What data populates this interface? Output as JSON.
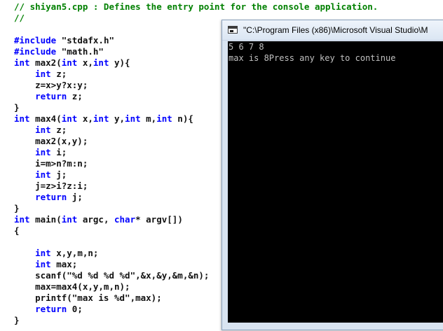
{
  "colors": {
    "comment": "#008000",
    "keyword": "#0000ff",
    "text": "#111111",
    "console_bg": "#000000",
    "console_text": "#c0c0c0"
  },
  "editor": {
    "lines": [
      [
        {
          "t": "cm",
          "s": "// shiyan5.cpp : Defines the entry point for the console application."
        }
      ],
      [
        {
          "t": "cm",
          "s": "//"
        }
      ],
      [],
      [
        {
          "t": "pp",
          "s": "#include"
        },
        {
          "t": "tx",
          "s": " \"stdafx.h\""
        }
      ],
      [
        {
          "t": "pp",
          "s": "#include"
        },
        {
          "t": "tx",
          "s": " \"math.h\""
        }
      ],
      [
        {
          "t": "kw",
          "s": "int"
        },
        {
          "t": "tx",
          "s": " max2("
        },
        {
          "t": "kw",
          "s": "int"
        },
        {
          "t": "tx",
          "s": " x,"
        },
        {
          "t": "kw",
          "s": "int"
        },
        {
          "t": "tx",
          "s": " y){"
        }
      ],
      [
        {
          "t": "tx",
          "s": "    "
        },
        {
          "t": "kw",
          "s": "int"
        },
        {
          "t": "tx",
          "s": " z;"
        }
      ],
      [
        {
          "t": "tx",
          "s": "    z=x>y?x:y;"
        }
      ],
      [
        {
          "t": "tx",
          "s": "    "
        },
        {
          "t": "kw",
          "s": "return"
        },
        {
          "t": "tx",
          "s": " z;"
        }
      ],
      [
        {
          "t": "tx",
          "s": "}"
        }
      ],
      [
        {
          "t": "kw",
          "s": "int"
        },
        {
          "t": "tx",
          "s": " max4("
        },
        {
          "t": "kw",
          "s": "int"
        },
        {
          "t": "tx",
          "s": " x,"
        },
        {
          "t": "kw",
          "s": "int"
        },
        {
          "t": "tx",
          "s": " y,"
        },
        {
          "t": "kw",
          "s": "int"
        },
        {
          "t": "tx",
          "s": " m,"
        },
        {
          "t": "kw",
          "s": "int"
        },
        {
          "t": "tx",
          "s": " n){"
        }
      ],
      [
        {
          "t": "tx",
          "s": "    "
        },
        {
          "t": "kw",
          "s": "int"
        },
        {
          "t": "tx",
          "s": " z;"
        }
      ],
      [
        {
          "t": "tx",
          "s": "    max2(x,y);"
        }
      ],
      [
        {
          "t": "tx",
          "s": "    "
        },
        {
          "t": "kw",
          "s": "int"
        },
        {
          "t": "tx",
          "s": " i;"
        }
      ],
      [
        {
          "t": "tx",
          "s": "    i=m>n?m:n;"
        }
      ],
      [
        {
          "t": "tx",
          "s": "    "
        },
        {
          "t": "kw",
          "s": "int"
        },
        {
          "t": "tx",
          "s": " j;"
        }
      ],
      [
        {
          "t": "tx",
          "s": "    j=z>i?z:i;"
        }
      ],
      [
        {
          "t": "tx",
          "s": "    "
        },
        {
          "t": "kw",
          "s": "return"
        },
        {
          "t": "tx",
          "s": " j;"
        }
      ],
      [
        {
          "t": "tx",
          "s": "}"
        }
      ],
      [
        {
          "t": "kw",
          "s": "int"
        },
        {
          "t": "tx",
          "s": " main("
        },
        {
          "t": "kw",
          "s": "int"
        },
        {
          "t": "tx",
          "s": " argc, "
        },
        {
          "t": "kw",
          "s": "char"
        },
        {
          "t": "tx",
          "s": "* argv[])"
        }
      ],
      [
        {
          "t": "tx",
          "s": "{"
        }
      ],
      [],
      [
        {
          "t": "tx",
          "s": "    "
        },
        {
          "t": "kw",
          "s": "int"
        },
        {
          "t": "tx",
          "s": " x,y,m,n;"
        }
      ],
      [
        {
          "t": "tx",
          "s": "    "
        },
        {
          "t": "kw",
          "s": "int"
        },
        {
          "t": "tx",
          "s": " max;"
        }
      ],
      [
        {
          "t": "tx",
          "s": "    scanf(\"%d %d %d %d\",&x,&y,&m,&n);"
        }
      ],
      [
        {
          "t": "tx",
          "s": "    max=max4(x,y,m,n);"
        }
      ],
      [
        {
          "t": "tx",
          "s": "    printf(\"max is %d\",max);"
        }
      ],
      [
        {
          "t": "tx",
          "s": "    "
        },
        {
          "t": "kw",
          "s": "return"
        },
        {
          "t": "tx",
          "s": " 0;"
        }
      ],
      [
        {
          "t": "tx",
          "s": "}"
        }
      ]
    ]
  },
  "console": {
    "title": "\"C:\\Program Files (x86)\\Microsoft Visual Studio\\M",
    "icon": "console-window-icon",
    "lines": [
      "5 6 7 8",
      "max is 8Press any key to continue"
    ]
  }
}
